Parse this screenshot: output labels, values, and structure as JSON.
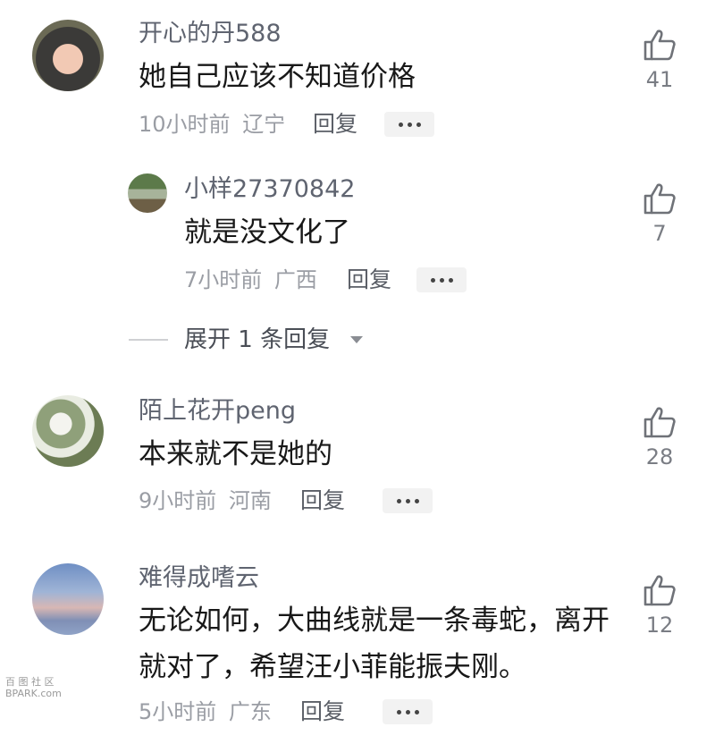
{
  "comments": [
    {
      "username": "开心的丹588",
      "text": "她自己应该不知道价格",
      "time": "10小时前",
      "location": "辽宁",
      "reply_label": "回复",
      "likes": "41"
    },
    {
      "username": "小样27370842",
      "text": "就是没文化了",
      "time": "7小时前",
      "location": "广西",
      "reply_label": "回复",
      "likes": "7"
    },
    {
      "username": "陌上花开peng",
      "text": "本来就不是她的",
      "time": "9小时前",
      "location": "河南",
      "reply_label": "回复",
      "likes": "28"
    },
    {
      "username": "难得成嗜云",
      "text": "无论如何，大曲线就是一条毒蛇，离开就对了，希望汪小菲能振夫刚。",
      "time": "5小时前",
      "location": "广东",
      "reply_label": "回复",
      "likes": "12"
    }
  ],
  "expand_replies": {
    "label": "展开 1 条回复"
  },
  "watermark": {
    "line1": "百 图 社 区",
    "line2": "BPARK.com"
  },
  "colors": {
    "text": "#181818",
    "username": "#5f6470",
    "meta": "#9a9da4",
    "icon": "#6f7278"
  }
}
